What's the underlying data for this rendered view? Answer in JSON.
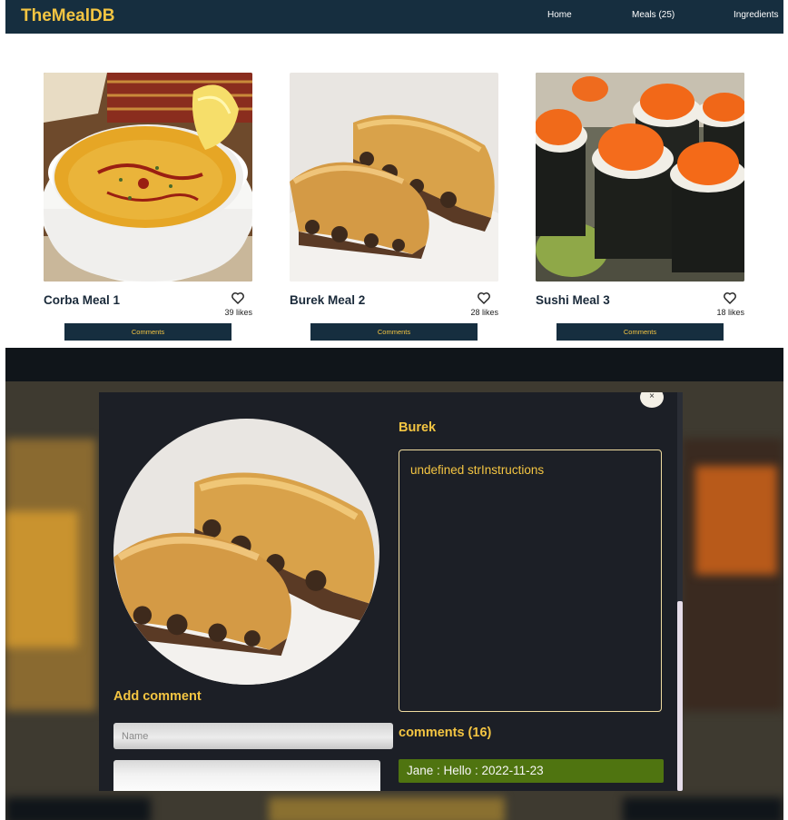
{
  "app": {
    "logo": "TheMealDB"
  },
  "nav": {
    "home": "Home",
    "meals": "Meals (25)",
    "ingredients": "Ingredients"
  },
  "meals": [
    {
      "title": "Corba Meal 1",
      "likes": "39 likes",
      "comments_label": "Comments"
    },
    {
      "title": "Burek Meal 2",
      "likes": "28 likes",
      "comments_label": "Comments"
    },
    {
      "title": "Sushi Meal 3",
      "likes": "18 likes",
      "comments_label": "Comments"
    }
  ],
  "popup": {
    "close": "×",
    "meal_name": "Burek",
    "instructions": "undefined strInstructions",
    "add_comment_heading": "Add comment",
    "name_placeholder": "Name",
    "comment_value": "",
    "comments_heading": "comments (16)",
    "comments": [
      "Jane : Hello : 2022-11-23"
    ]
  },
  "colors": {
    "nav_bg": "#162e3f",
    "accent_yellow": "#f4c542",
    "modal_bg": "#1c1f26",
    "comment_green": "#4f7410"
  },
  "icons": {
    "like": "heart-outline-icon",
    "close": "close-icon"
  }
}
